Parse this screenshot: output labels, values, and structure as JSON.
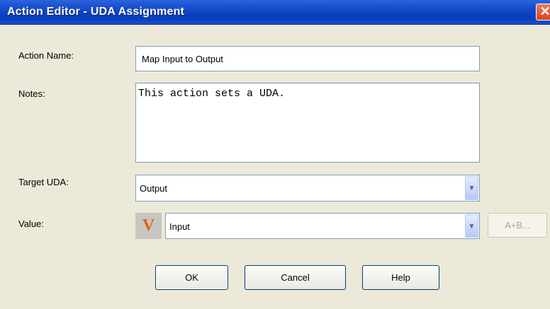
{
  "window": {
    "title": "Action Editor - UDA Assignment",
    "close_icon": "close-icon"
  },
  "form": {
    "action_name_label": "Action Name:",
    "action_name_value": "Map Input to Output",
    "notes_label": "Notes:",
    "notes_value": "This action sets a UDA.",
    "target_uda_label": "Target UDA:",
    "target_uda_value": "Output",
    "value_label": "Value:",
    "value_type_icon": "V",
    "value_value": "Input",
    "expression_button_label": "A+B..."
  },
  "buttons": {
    "ok": "OK",
    "cancel": "Cancel",
    "help": "Help"
  }
}
